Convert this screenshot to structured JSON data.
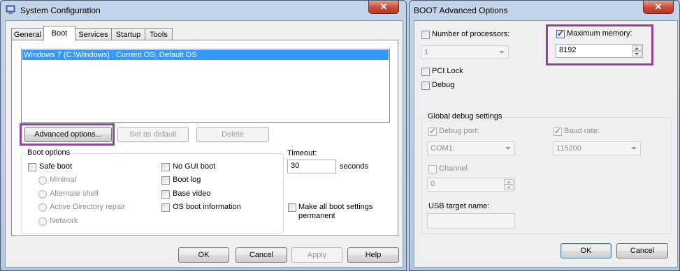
{
  "left_window": {
    "title": "System Configuration",
    "close_glyph": "✕",
    "tabs": [
      {
        "label": "General"
      },
      {
        "label": "Boot"
      },
      {
        "label": "Services"
      },
      {
        "label": "Startup"
      },
      {
        "label": "Tools"
      }
    ],
    "os_list": [
      "Windows 7 (C:\\Windows) : Current OS; Default OS"
    ],
    "buttons": {
      "advanced": "Advanced options...",
      "set_default": "Set as default",
      "delete": "Delete"
    },
    "boot_options": {
      "group_title": "Boot options",
      "safe_boot": "Safe boot",
      "minimal": "Minimal",
      "alternate_shell": "Alternate shell",
      "ad_repair": "Active Directory repair",
      "network": "Network",
      "no_gui_boot": "No GUI boot",
      "boot_log": "Boot log",
      "base_video": "Base video",
      "os_boot_info": "OS boot information"
    },
    "timeout": {
      "label": "Timeout:",
      "value": "30",
      "unit": "seconds"
    },
    "make_permanent": {
      "line1": "Make all boot settings",
      "line2": "permanent"
    },
    "footer": {
      "ok": "OK",
      "cancel": "Cancel",
      "apply": "Apply",
      "help": "Help"
    }
  },
  "right_window": {
    "title": "BOOT Advanced Options",
    "close_glyph": "✕",
    "num_processors": {
      "label": "Number of processors:",
      "value": "1",
      "checked": false
    },
    "max_memory": {
      "label": "Maximum memory:",
      "value": "8192",
      "checked": true
    },
    "pci_lock": "PCI Lock",
    "debug": "Debug",
    "global_debug": {
      "group_title": "Global debug settings",
      "debug_port": {
        "label": "Debug port:",
        "value": "COM1:"
      },
      "baud_rate": {
        "label": "Baud rate:",
        "value": "115200"
      },
      "channel": {
        "label": "Channel",
        "value": "0"
      },
      "usb_target": {
        "label": "USB target name:",
        "value": ""
      }
    },
    "footer": {
      "ok": "OK",
      "cancel": "Cancel"
    }
  },
  "colors": {
    "selection": "#3399ff",
    "highlight_box": "#9a3ea0"
  }
}
